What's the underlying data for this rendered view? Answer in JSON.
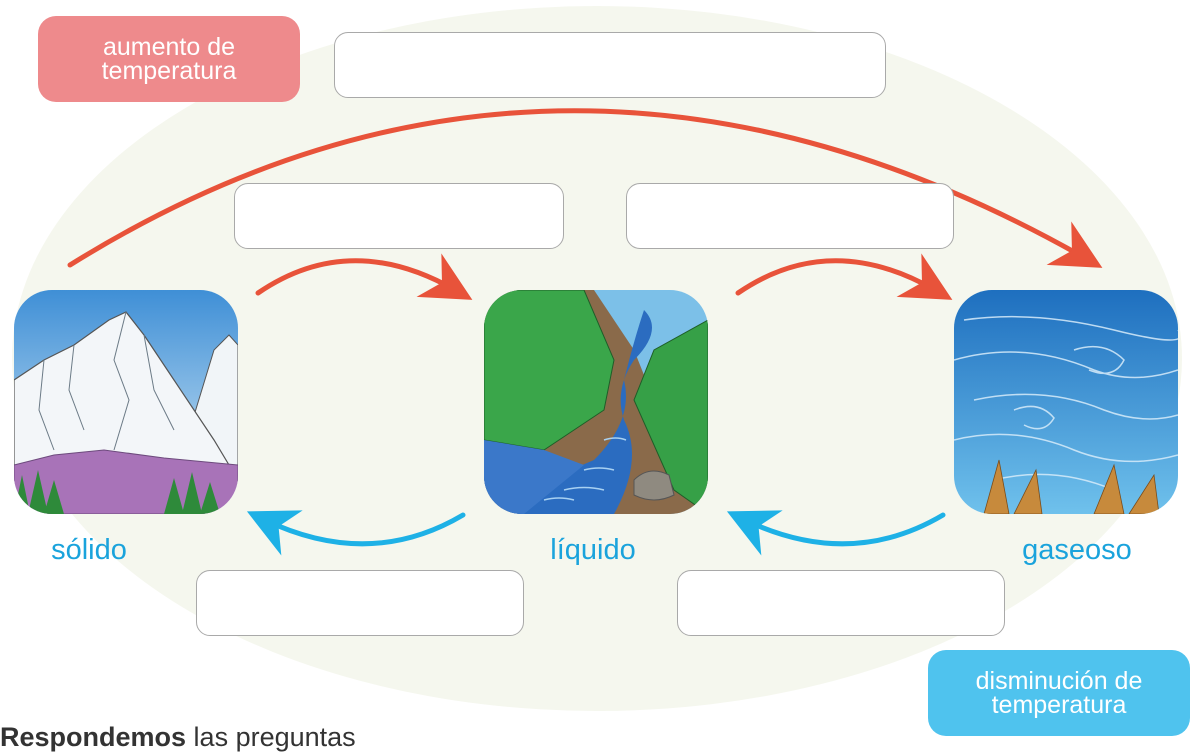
{
  "tags": {
    "increase_line1": "aumento de",
    "increase_line2": "temperatura",
    "decrease_line1": "disminución de",
    "decrease_line2": "temperatura"
  },
  "states": {
    "solid": "sólido",
    "liquid": "líquido",
    "gas": "gaseoso"
  },
  "footer": {
    "bold": "Respondemos",
    "rest": " las preguntas"
  },
  "colors": {
    "increase_arrow": "#e8533a",
    "decrease_arrow": "#1eb1e6",
    "increase_tag": "#ee8a8c",
    "decrease_tag": "#4fc3ee",
    "state_label": "#1aa3dc"
  }
}
